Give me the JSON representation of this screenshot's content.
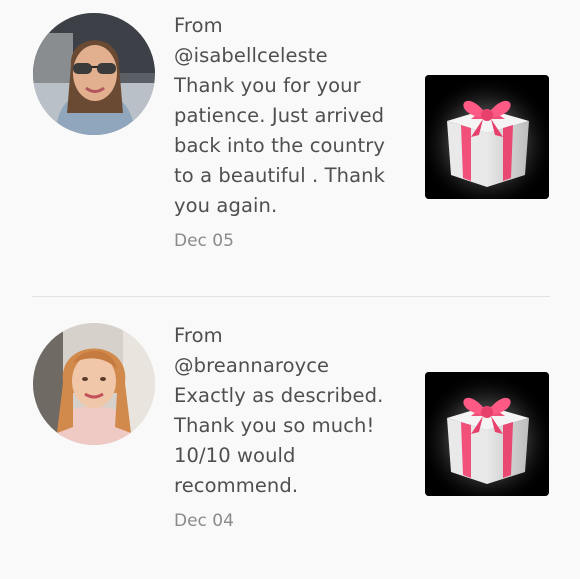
{
  "reviews": [
    {
      "from_label": "From",
      "handle": "@isabellceleste",
      "message": "Thank you for your\npatience. Just arrived\nback into the country\nto a beautiful . Thank\nyou again.",
      "date": "Dec 05",
      "avatar_icon": "user-photo-sunglasses",
      "gift_icon": "gift-box-icon"
    },
    {
      "from_label": "From",
      "handle": "@breannaroyce",
      "message": "Exactly as described.\nThank you so much!\n10/10 would\nrecommend.",
      "date": "Dec 04",
      "avatar_icon": "user-photo-blonde",
      "gift_icon": "gift-box-icon"
    }
  ],
  "colors": {
    "text": "#4f4f4f",
    "date": "#8a8a8a",
    "divider": "#e2e2e2",
    "background": "#f9f9f9",
    "ribbon": "#f0507a",
    "gift_bg": "#000000"
  }
}
